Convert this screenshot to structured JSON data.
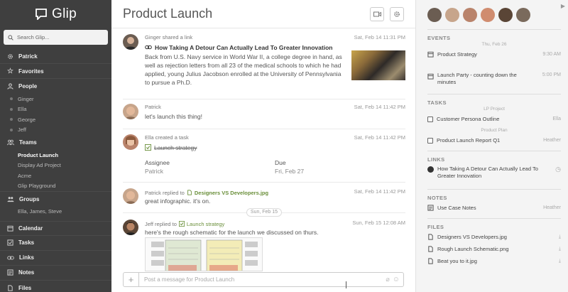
{
  "app": {
    "name": "Glip"
  },
  "sidebar": {
    "search_placeholder": "Search Glip...",
    "user": "Patrick",
    "favorites": "Favorites",
    "people": {
      "label": "People",
      "items": [
        "Ginger",
        "Ella",
        "George",
        "Jeff"
      ]
    },
    "teams": {
      "label": "Teams",
      "items": [
        "Product Launch",
        "Display Ad Project",
        "Acme",
        "Glip Playground"
      ]
    },
    "groups": {
      "label": "Groups",
      "items": [
        "Ella, James, Steve"
      ]
    },
    "calendar": "Calendar",
    "tasks": "Tasks",
    "links": "Links",
    "notes": "Notes",
    "files": "Files"
  },
  "main": {
    "title": "Product Launch",
    "posts": [
      {
        "author_line": "Ginger shared a link",
        "time": "Sat, Feb 14 11:31 PM",
        "link_title": "How Taking A Detour Can Actually Lead To Greater Innovation",
        "text": "Back from U.S. Navy service in World War II, a college degree in hand, as well as rejection letters from all 23 of the medical schools to which he had applied, young Julius Jacobson enrolled at the University of Pennsylvania to pursue a Ph.D."
      },
      {
        "author_line": "Patrick",
        "time": "Sat, Feb 14 11:42 PM",
        "text": "let's launch this thing!"
      },
      {
        "author_line": "Ella created a task",
        "time": "Sat, Feb 14 11:42 PM",
        "task": "Launch strategy",
        "assignee_label": "Assignee",
        "assignee": "Patrick",
        "due_label": "Due",
        "due": "Fri, Feb 27"
      },
      {
        "author_prefix": "Patrick replied to",
        "file": "Designers VS Developers.jpg",
        "time": "Sat, Feb 14 11:42 PM",
        "text": "great infographic. it's on."
      },
      {
        "author_prefix": "Jeff replied to",
        "task": "Launch strategy",
        "time": "Sun, Feb 15 12:08 AM",
        "text": "here's the rough schematic for the launch we discussed on thurs."
      }
    ],
    "date_divider": "Sun, Feb 15",
    "composer_placeholder": "Post a message for Product Launch"
  },
  "right": {
    "events": {
      "label": "EVENTS",
      "date": "Thu, Feb 26",
      "items": [
        {
          "title": "Product Strategy",
          "time": "9:30 AM"
        },
        {
          "title": "Launch Party - counting down the minutes",
          "time": "5:00 PM"
        }
      ]
    },
    "tasks": {
      "label": "TASKS",
      "items": [
        {
          "group": "LP Project",
          "title": "Customer Persona Outline",
          "who": "Ella"
        },
        {
          "group": "Product Plan",
          "title": "Product Launch Report Q1",
          "who": "Heather"
        }
      ]
    },
    "links": {
      "label": "LINKS",
      "items": [
        "How Taking A Detour Can Actually Lead To Greater Innovation"
      ]
    },
    "notes": {
      "label": "NOTES",
      "items": [
        {
          "title": "Use Case Notes",
          "who": "Heather"
        }
      ]
    },
    "files": {
      "label": "FILES",
      "items": [
        "Designers VS Developers.jpg",
        "Rough Launch Schematic.png",
        "Beat you to it.jpg"
      ]
    }
  },
  "colors": {
    "sidebar": "#3f3f3f",
    "accent_green": "#6a8f3a",
    "panel": "#f4f4f4"
  }
}
